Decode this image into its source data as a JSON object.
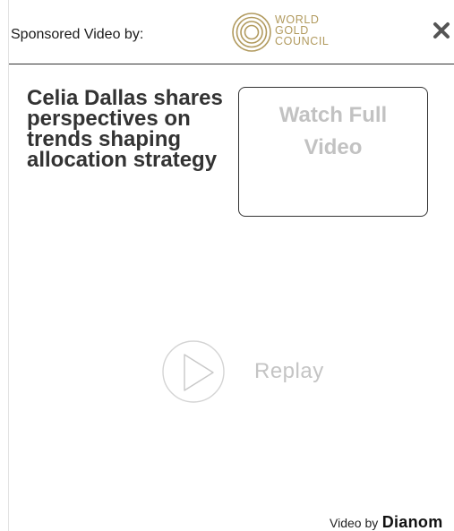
{
  "header": {
    "sponsor_label": "Sponsored Video by:",
    "logo": {
      "icon": "concentric-rings-logo",
      "lines": [
        "WORLD",
        "GOLD",
        "COUNCIL"
      ],
      "color": "#b19a5e"
    },
    "close_icon": "close-icon"
  },
  "video": {
    "title": "Celia Dallas shares perspectives on trends shaping allocation strategy",
    "watch_button": {
      "line1": "Watch Full",
      "line2": "Video"
    },
    "replay": {
      "icon": "play-icon",
      "label": "Replay"
    }
  },
  "footer": {
    "credit_prefix": "Video by",
    "brand": "Dianom"
  }
}
